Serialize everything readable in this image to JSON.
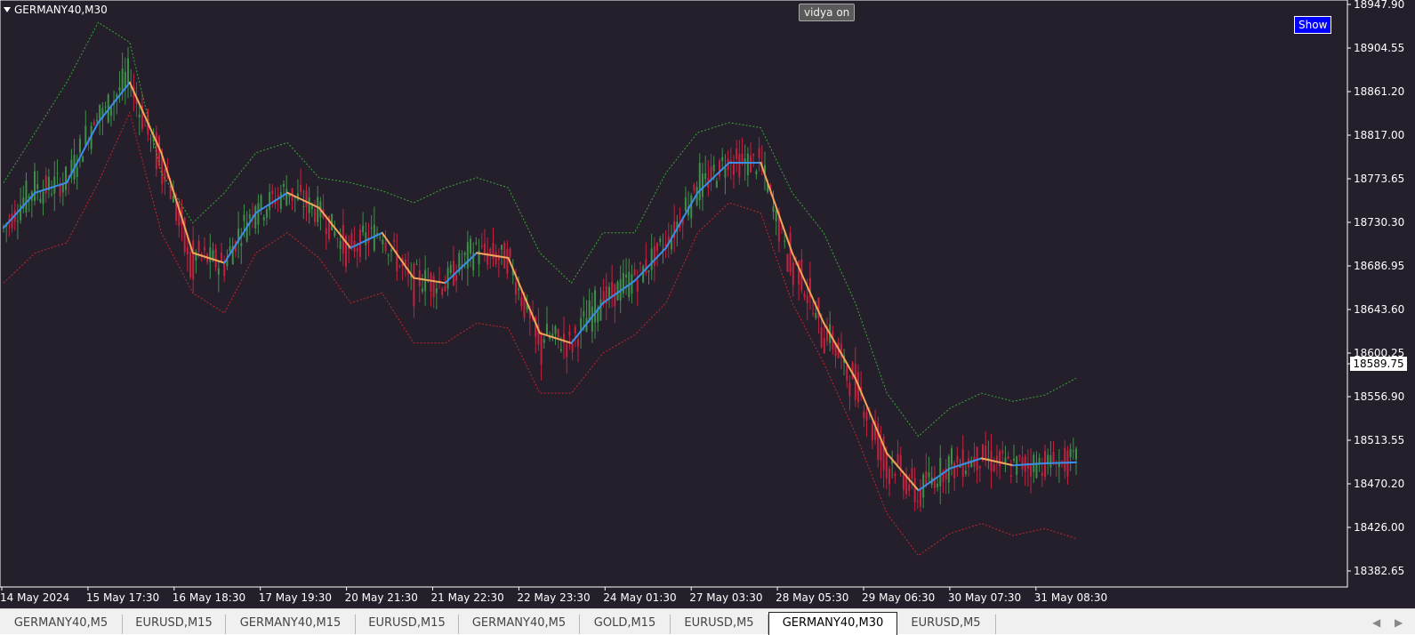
{
  "window": {
    "symbol_label": "GERMANY40,M30"
  },
  "buttons": {
    "vidya": "vidya on",
    "show": "Show"
  },
  "price_axis": {
    "labels": [
      "18947.90",
      "18904.55",
      "18861.20",
      "18817.00",
      "18773.65",
      "18730.30",
      "18686.95",
      "18643.60",
      "18600.25",
      "18556.90",
      "18513.55",
      "18470.20",
      "18426.00",
      "18382.65"
    ],
    "current_price": "18589.75"
  },
  "time_axis": {
    "labels": [
      "14 May 2024",
      "15 May 17:30",
      "16 May 18:30",
      "17 May 19:30",
      "20 May 21:30",
      "21 May 22:30",
      "22 May 23:30",
      "24 May 01:30",
      "27 May 03:30",
      "28 May 05:30",
      "29 May 06:30",
      "30 May 07:30",
      "31 May 08:30"
    ]
  },
  "tabs": [
    {
      "label": "GERMANY40,M5",
      "active": false
    },
    {
      "label": "EURUSD,M15",
      "active": false
    },
    {
      "label": "GERMANY40,M15",
      "active": false
    },
    {
      "label": "EURUSD,M15",
      "active": false
    },
    {
      "label": "GERMANY40,M5",
      "active": false
    },
    {
      "label": "GOLD,M15",
      "active": false
    },
    {
      "label": "EURUSD,M5",
      "active": false
    },
    {
      "label": "GERMANY40,M30",
      "active": true
    },
    {
      "label": "EURUSD,M5",
      "active": false
    }
  ],
  "colors": {
    "background": "#241f2b",
    "bull": "#3f8f4a",
    "bear": "#c3223f",
    "vidya_up": "#3a8ee6",
    "vidya_down": "#f2a65a",
    "band_upper": "#3aa63a",
    "band_lower": "#c0272d",
    "axis_text": "#ffffff"
  },
  "chart_data": {
    "type": "line",
    "y_axis": {
      "min": 18382.65,
      "max": 18947.9
    },
    "x_labels": [
      "14 May 2024",
      "15 May 17:30",
      "16 May 18:30",
      "17 May 19:30",
      "20 May 21:30",
      "21 May 22:30",
      "22 May 23:30",
      "24 May 01:30",
      "27 May 03:30",
      "28 May 05:30",
      "29 May 06:30",
      "30 May 07:30",
      "31 May 08:30"
    ],
    "series": [
      {
        "name": "vidya",
        "values": [
          18725,
          18760,
          18770,
          18830,
          18870,
          18800,
          18700,
          18690,
          18740,
          18760,
          18745,
          18705,
          18720,
          18675,
          18670,
          18700,
          18695,
          18620,
          18610,
          18650,
          18672,
          18705,
          18760,
          18790,
          18790,
          18700,
          18630,
          18575,
          18500,
          18463,
          18485,
          18495,
          18488,
          18490,
          18491
        ]
      },
      {
        "name": "upper band",
        "values": [
          18770,
          18820,
          18870,
          18930,
          18910,
          18780,
          18730,
          18760,
          18800,
          18810,
          18775,
          18770,
          18762,
          18750,
          18765,
          18775,
          18765,
          18700,
          18670,
          18720,
          18720,
          18780,
          18820,
          18830,
          18825,
          18760,
          18720,
          18650,
          18560,
          18517,
          18545,
          18560,
          18552,
          18558,
          18575
        ]
      },
      {
        "name": "lower band",
        "values": [
          18670,
          18700,
          18710,
          18770,
          18840,
          18720,
          18660,
          18640,
          18700,
          18720,
          18695,
          18650,
          18660,
          18610,
          18610,
          18630,
          18625,
          18560,
          18560,
          18600,
          18618,
          18650,
          18720,
          18750,
          18740,
          18650,
          18590,
          18520,
          18440,
          18398,
          18420,
          18430,
          18418,
          18425,
          18415
        ]
      }
    ]
  }
}
